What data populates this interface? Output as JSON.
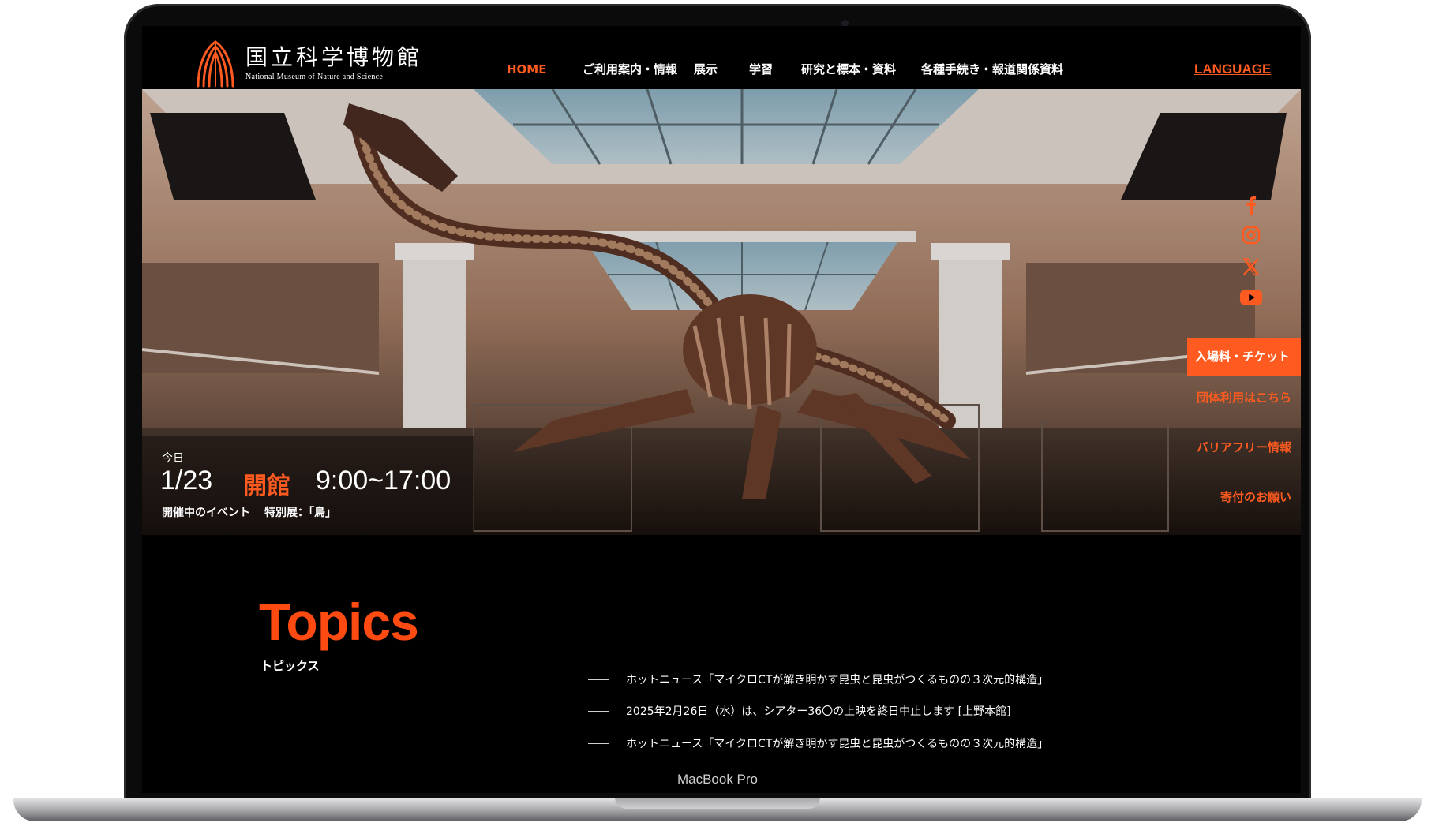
{
  "device": {
    "model_label": "MacBook Pro"
  },
  "header": {
    "logo_jp": "国立科学博物館",
    "logo_en": "National Museum of Nature and Science",
    "nav": [
      {
        "label": "HOME",
        "active": true
      },
      {
        "label": "ご利用案内・情報",
        "active": false
      },
      {
        "label": "展示",
        "active": false
      },
      {
        "label": "学習",
        "active": false
      },
      {
        "label": "研究と標本・資料",
        "active": false
      },
      {
        "label": "各種手続き・報道関係資料",
        "active": false
      }
    ],
    "language_label": "LANGUAGE"
  },
  "hero": {
    "today_label": "今日",
    "date": "1/23",
    "status": "開館",
    "hours": "9:00~17:00",
    "event_prefix": "開催中のイベント",
    "event_name": "特別展：「鳥」"
  },
  "social": [
    {
      "icon": "facebook-icon"
    },
    {
      "icon": "instagram-icon"
    },
    {
      "icon": "x-icon"
    },
    {
      "icon": "youtube-icon"
    }
  ],
  "side_actions": {
    "tickets": "入場料・チケット",
    "group": "団体利用はこちら",
    "barrier_free": "バリアフリー情報",
    "donation": "寄付のお願い"
  },
  "topics": {
    "title": "Topics",
    "subtitle": "トピックス",
    "items": [
      "ホットニュース「マイクロCTが解き明かす昆虫と昆虫がつくるものの３次元的構造」",
      "2025年2月26日（水）は、シアター36〇の上映を終日中止します [上野本館]",
      "ホットニュース「マイクロCTが解き明かす昆虫と昆虫がつくるものの３次元的構造」"
    ]
  },
  "colors": {
    "accent": "#ff5a1f",
    "background": "#000000",
    "text": "#ffffff"
  }
}
